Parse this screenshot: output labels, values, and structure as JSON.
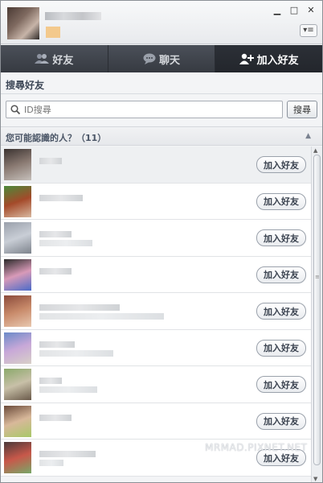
{
  "window": {
    "controls": {
      "minimize": "▁",
      "maximize": "□",
      "close": "✕"
    },
    "menu_icon": "▾≡"
  },
  "tabs": [
    {
      "label": "好友",
      "icon": "friends-icon",
      "active": false
    },
    {
      "label": "聊天",
      "icon": "chat-bubble-icon",
      "active": false
    },
    {
      "label": "加入好友",
      "icon": "add-user-icon",
      "active": true
    }
  ],
  "search": {
    "section_label": "搜尋好友",
    "placeholder": "ID搜尋",
    "button_label": "搜尋"
  },
  "suggestions": {
    "title": "您可能認識的人？（11）",
    "collapse_icon": "▲",
    "add_button_label": "加入好友",
    "rows": [
      {
        "avatar_colors": [
          "#3a3230",
          "#8a7a72",
          "#c6c0bb"
        ]
      },
      {
        "avatar_colors": [
          "#4a8a3a",
          "#a44a2a",
          "#d8b8a0"
        ]
      },
      {
        "avatar_colors": [
          "#9aa0ab",
          "#c9ced6",
          "#7d838c"
        ]
      },
      {
        "avatar_colors": [
          "#2a2a2a",
          "#d89ab8",
          "#4a6ac8"
        ]
      },
      {
        "avatar_colors": [
          "#8a4a3a",
          "#c88a6a",
          "#e8c8b0"
        ]
      },
      {
        "avatar_colors": [
          "#6a8ac8",
          "#c8a8d8",
          "#d8d0c8"
        ]
      },
      {
        "avatar_colors": [
          "#8aa86a",
          "#c8c0a8",
          "#6a5a4a"
        ]
      },
      {
        "avatar_colors": [
          "#6a4a3a",
          "#d8b89a",
          "#a8c868"
        ]
      },
      {
        "avatar_colors": [
          "#4a3a3a",
          "#c8584a",
          "#78a868"
        ]
      }
    ]
  },
  "watermark": "MRMAD.PIXNET.NET"
}
